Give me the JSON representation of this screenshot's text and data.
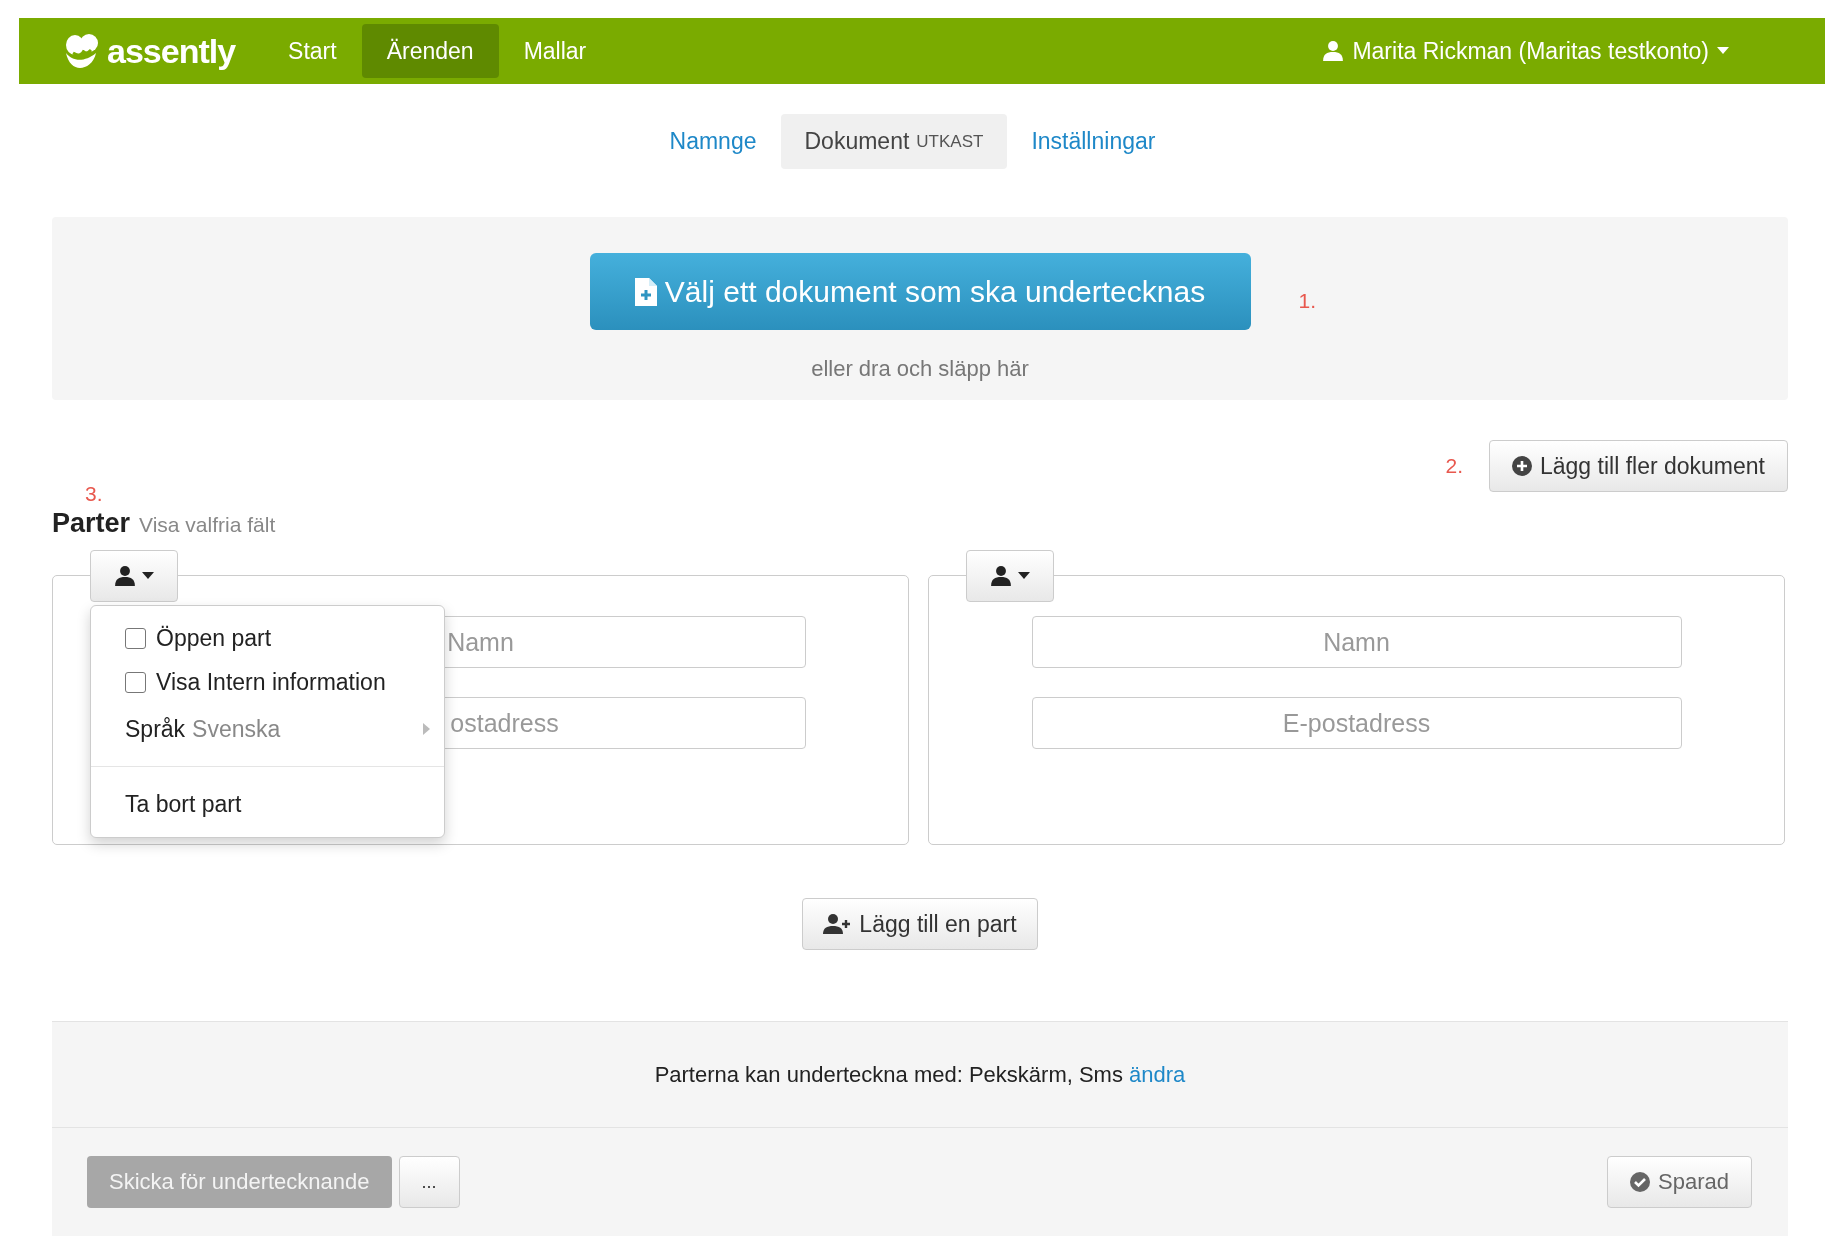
{
  "header": {
    "logo": "assently",
    "nav": [
      {
        "label": "Start",
        "selected": false
      },
      {
        "label": "Ärenden",
        "selected": true
      },
      {
        "label": "Mallar",
        "selected": false
      }
    ],
    "user": "Marita Rickman (Maritas testkonto)"
  },
  "tabs": [
    {
      "label": "Namnge",
      "selected": false
    },
    {
      "label": "Dokument",
      "badge": "UTKAST",
      "selected": true
    },
    {
      "label": "Inställningar",
      "selected": false
    }
  ],
  "upload": {
    "button": "Välj ett dokument som ska undertecknas",
    "hint": "eller dra och släpp här",
    "step": "1."
  },
  "add_document": {
    "step": "2.",
    "button": "Lägg till fler dokument"
  },
  "parties": {
    "step": "3.",
    "title": "Parter",
    "link": "Visa valfria fält",
    "cards": [
      {
        "name_placeholder": "Namn",
        "email_placeholder": "ostadress",
        "menu": {
          "items": [
            {
              "kind": "checkbox",
              "label": "Öppen part",
              "checked": false
            },
            {
              "kind": "checkbox",
              "label": "Visa Intern information",
              "checked": false
            },
            {
              "kind": "submenu",
              "label": "Språk",
              "value": "Svenska"
            },
            {
              "kind": "divider"
            },
            {
              "kind": "action",
              "label": "Ta bort part"
            }
          ]
        }
      },
      {
        "name_placeholder": "Namn",
        "email_placeholder": "E-postadress"
      }
    ],
    "add_button": "Lägg till en part"
  },
  "signing": {
    "text": "Parterna kan underteckna med: Pekskärm, Sms",
    "link": "ändra"
  },
  "footer": {
    "send": {
      "label": "Skicka för undertecknande",
      "disabled": true
    },
    "more": "...",
    "saved": "Sparad"
  }
}
